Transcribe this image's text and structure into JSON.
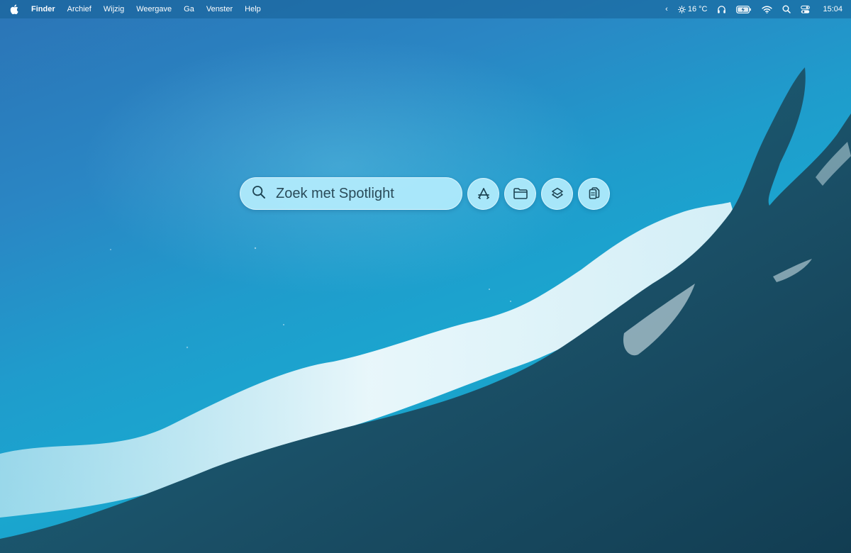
{
  "menubar": {
    "app_name": "Finder",
    "menus": [
      "Archief",
      "Wijzig",
      "Weergave",
      "Ga",
      "Venster",
      "Help"
    ],
    "status": {
      "chevron": "‹",
      "weather": "16 °C",
      "clock": "15:04"
    },
    "icons": [
      "apple-icon",
      "chevron-left-icon",
      "sun-icon",
      "headphones-icon",
      "battery-charging-icon",
      "wifi-icon",
      "search-icon",
      "control-center-icon"
    ]
  },
  "spotlight": {
    "placeholder": "Zoek met Spotlight",
    "buttons": [
      "app-store-icon",
      "folder-icon",
      "shortcuts-icon",
      "clipboard-icon"
    ]
  },
  "colors": {
    "menubar": "#166096",
    "spotlight_fill": "#b9f0ff",
    "spotlight_text": "#1d3f4e",
    "icon_stroke": "#1d4352"
  }
}
